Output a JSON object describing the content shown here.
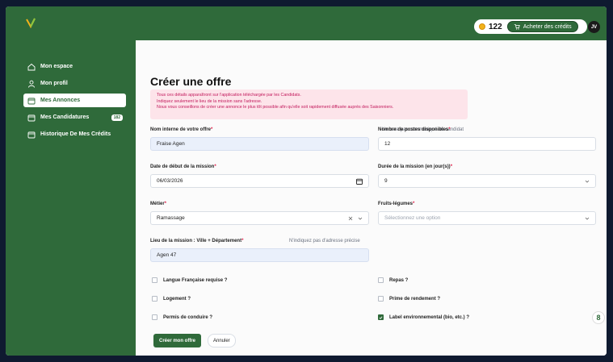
{
  "header": {
    "credits": "122",
    "buy_label": "Acheter des crédits",
    "avatar_initials": "JV",
    "accent": "#2f6a3a"
  },
  "sidebar": {
    "items": [
      {
        "label": "Mon espace",
        "icon": "home-icon"
      },
      {
        "label": "Mon profil",
        "icon": "user-icon"
      },
      {
        "label": "Mes Annonces",
        "icon": "folder-icon"
      },
      {
        "label": "Mes Candidatures",
        "icon": "folder-icon",
        "badge": "182"
      },
      {
        "label": "Historique De Mes Crédits",
        "icon": "folder-icon"
      }
    ]
  },
  "form": {
    "title": "Créer une offre",
    "info_lines": [
      "Tous ces détails apparaîtront sur l'application téléchargée par les Candidats.",
      "Indiquez seulement le lieu de la mission sans l'adresse.",
      "Nous vous conseillons de créer une annonce le plus tôt possible afin qu'elle soit rapidement diffusée auprès des Saisonniers."
    ],
    "internal_name_label": "Nom interne de votre offre",
    "internal_name_hint": "Ne sera pas communiqué au candidat",
    "internal_name_value": "Fraise Agen",
    "positions_label": "Nombre de postes disponibles",
    "positions_value": "12",
    "start_date_label": "Date de début de la mission",
    "start_date_value": "06/03/2026",
    "duration_label": "Durée de la mission (en jour(s))",
    "duration_value": "9",
    "job_label": "Métier",
    "job_value": "Ramassage",
    "crop_label": "Fruits-légumes",
    "crop_placeholder": "Sélectionnez une option",
    "location_label": "Lieu de la mission : Ville + Département",
    "location_hint": "N'indiquez pas d'adresse précise",
    "location_value": "Agen 47",
    "checkboxes": {
      "french": "Langue Française requise ?",
      "meals": "Repas ?",
      "housing": "Logement ?",
      "bonus": "Prime de rendement ?",
      "license": "Permis de conduire ?",
      "eco_label": "Label environnemental (bio, etc.) ?"
    },
    "submit_label": "Créer mon offre",
    "cancel_label": "Annuler"
  }
}
